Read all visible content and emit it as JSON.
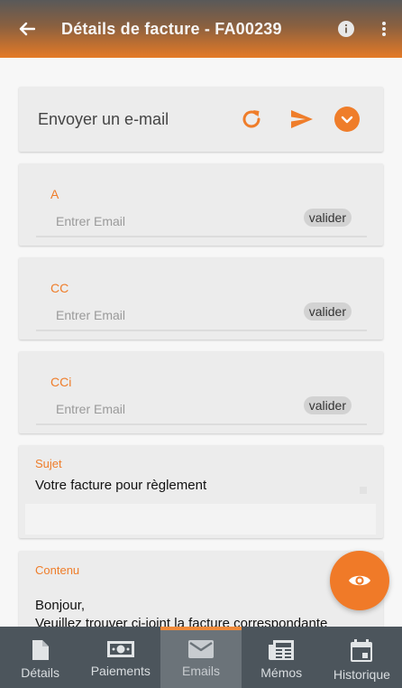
{
  "appbar": {
    "title": "Détails de facture - FA00239"
  },
  "send": {
    "label": "Envoyer un e-mail"
  },
  "recipients": [
    {
      "label": "A",
      "placeholder": "Entrer Email",
      "validate": "valider"
    },
    {
      "label": "CC",
      "placeholder": "Entrer Email",
      "validate": "valider"
    },
    {
      "label": "CCi",
      "placeholder": "Entrer Email",
      "validate": "valider"
    }
  ],
  "subject": {
    "label": "Sujet",
    "value": "Votre facture pour règlement"
  },
  "body": {
    "label": "Contenu",
    "line1": "Bonjour,",
    "line2": "Veuillez trouver ci-joint la facture correspondante"
  },
  "nav": [
    {
      "label": "Détails",
      "icon": "document-icon"
    },
    {
      "label": "Paiements",
      "icon": "money-icon"
    },
    {
      "label": "Emails",
      "icon": "mail-icon",
      "active": true
    },
    {
      "label": "Mémos",
      "icon": "newspaper-icon"
    },
    {
      "label": "Historique",
      "icon": "calendar-icon"
    }
  ],
  "colors": {
    "accent": "#f07a28",
    "label": "#ef7d2a",
    "nav_bg": "#4c555c",
    "nav_active": "#6b7379"
  }
}
